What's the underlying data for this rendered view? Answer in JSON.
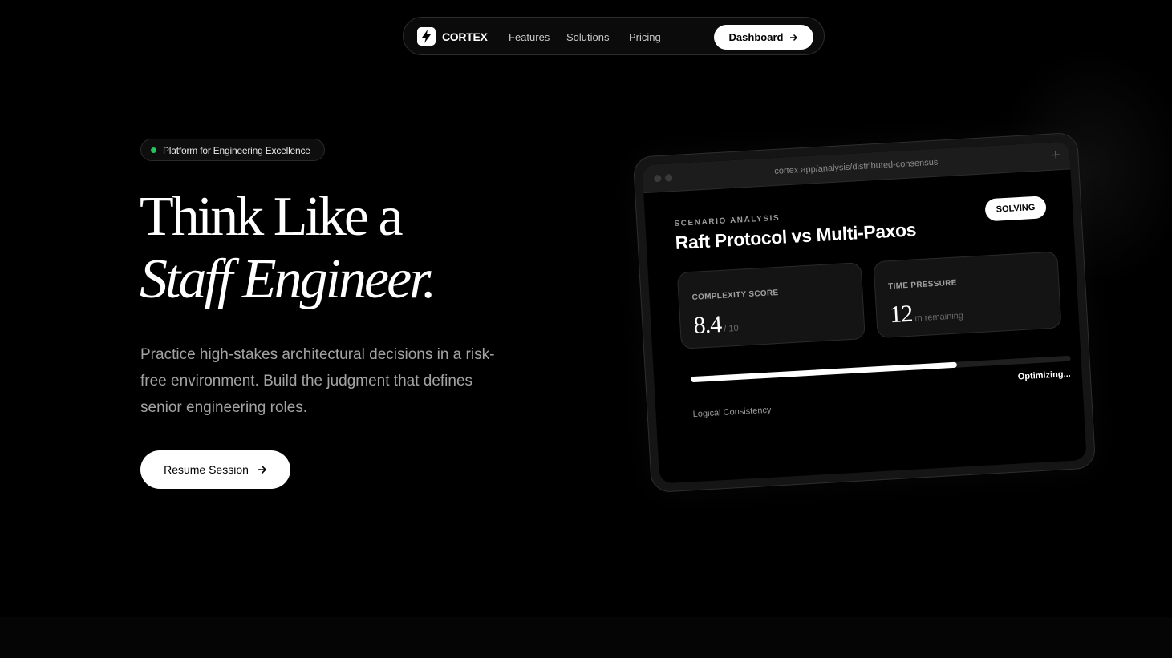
{
  "nav": {
    "brand": "CORTEX",
    "links": [
      "Features",
      "Solutions",
      "Pricing"
    ],
    "cta_label": "Dashboard"
  },
  "hero": {
    "badge": "Platform for Engineering Excellence",
    "headline_line1": "Think Like a",
    "headline_line2": "Staff Engineer.",
    "subtext": "Practice high-stakes architectural decisions in a risk-free environment. Build the judgment that defines senior engineering roles.",
    "cta_label": "Resume Session"
  },
  "mockup": {
    "url": "cortex.app/analysis/distributed-consensus",
    "plus": "+",
    "section_label": "SCENARIO ANALYSIS",
    "title": "Raft Protocol vs Multi-Paxos",
    "status": "SOLVING",
    "complexity_label": "COMPLEXITY SCORE",
    "complexity_value": "8.4",
    "complexity_suffix": "/ 10",
    "time_label": "TIME PRESSURE",
    "time_value": "12",
    "time_suffix": "m remaining",
    "progress_fraction": 0.7,
    "progress_status": "Optimizing...",
    "progress_label": "Logical Consistency"
  },
  "colors": {
    "background": "#000000",
    "accent_dot": "#22c55e",
    "button_bg": "#ffffff"
  }
}
